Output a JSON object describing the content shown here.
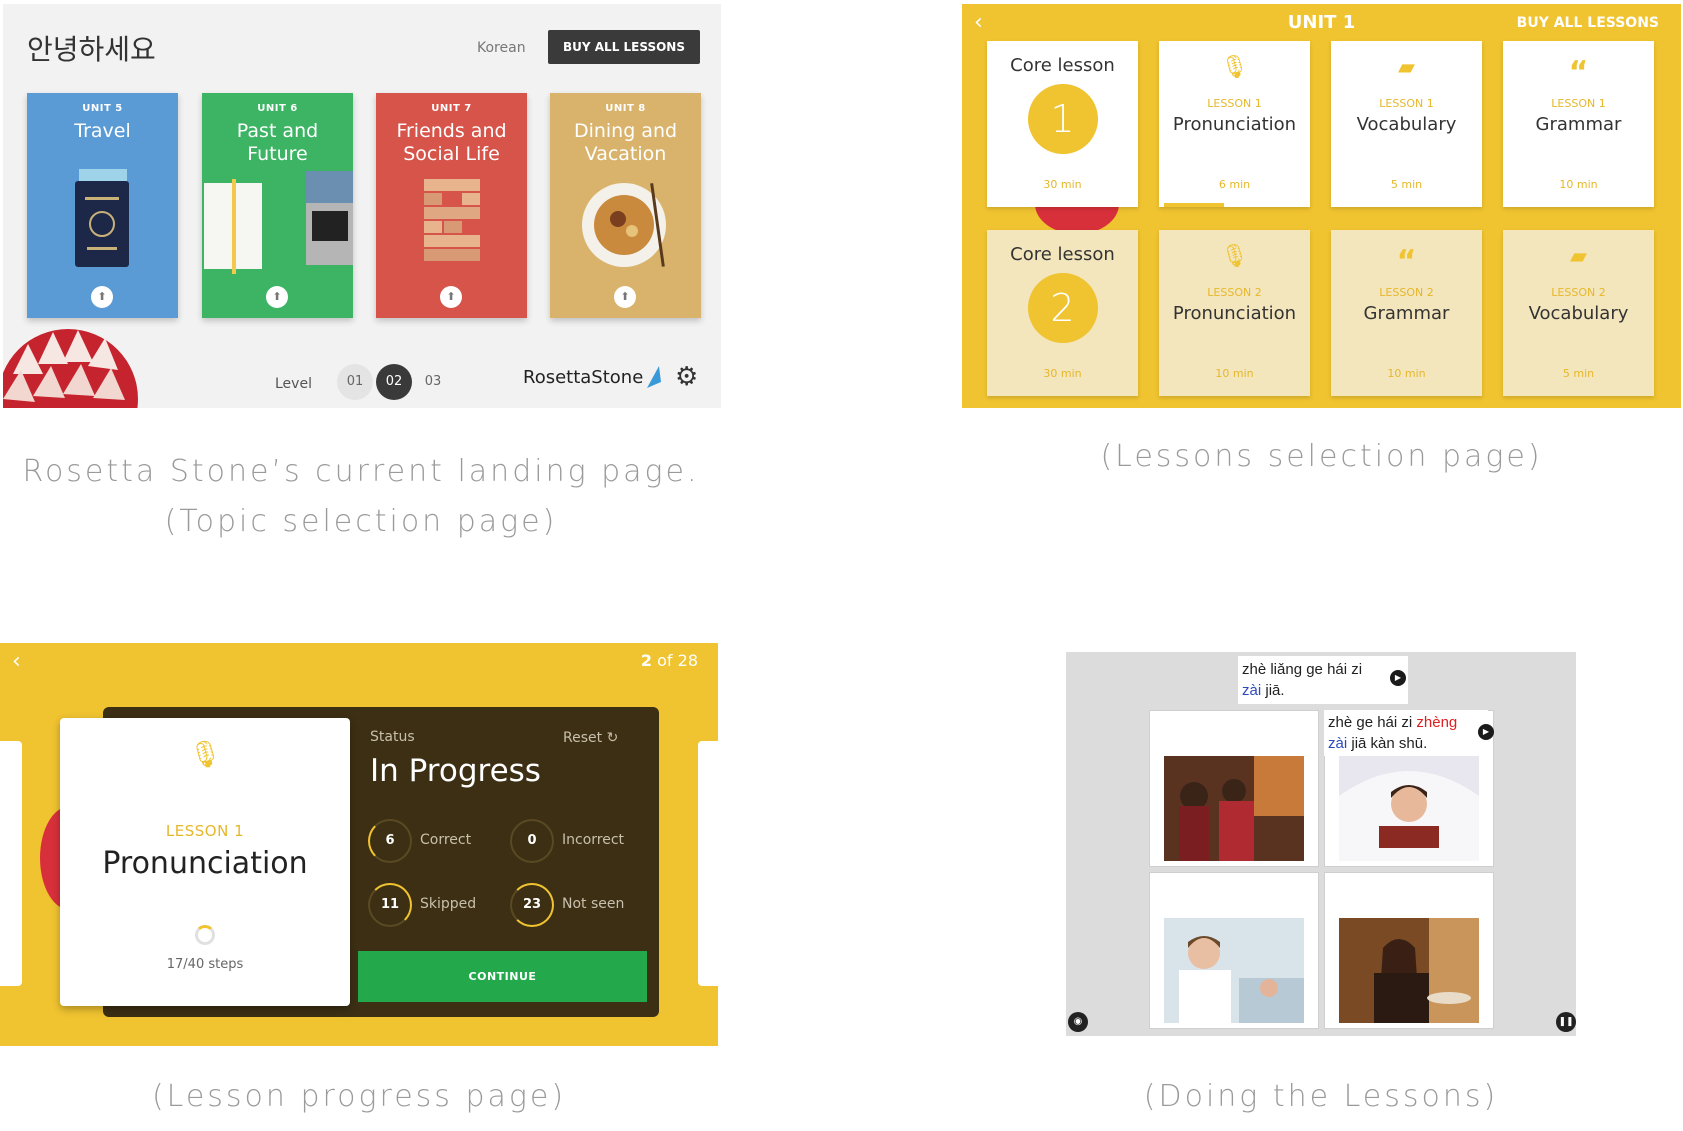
{
  "landing": {
    "greeting": "안녕하세요",
    "language": "Korean",
    "buy_all": "BUY ALL LESSONS",
    "units": [
      {
        "label": "UNIT 5",
        "title": "Travel",
        "color": "#5b9bd5"
      },
      {
        "label": "UNIT 6",
        "title": "Past and Future",
        "color": "#3cb464"
      },
      {
        "label": "UNIT 7",
        "title": "Friends and Social Life",
        "color": "#d6544a"
      },
      {
        "label": "UNIT 8",
        "title": "Dining and Vacation",
        "color": "#d9b36b"
      }
    ],
    "level_label": "Level",
    "levels": [
      "01",
      "02",
      "03"
    ],
    "selected_level": "02",
    "brand": "RosettaStone"
  },
  "lessons_page": {
    "title": "UNIT 1",
    "buy_all": "BUY ALL LESSONS",
    "row1": [
      {
        "type": "core",
        "title": "Core lesson",
        "number": "1",
        "duration": "30 min"
      },
      {
        "type": "lesson",
        "icon": "microphone-icon",
        "lesson": "LESSON 1",
        "name": "Pronunciation",
        "duration": "6 min",
        "progress": 0.4
      },
      {
        "type": "lesson",
        "icon": "book-icon",
        "lesson": "LESSON 1",
        "name": "Vocabulary",
        "duration": "5 min"
      },
      {
        "type": "lesson",
        "icon": "quote-icon",
        "lesson": "LESSON 1",
        "name": "Grammar",
        "duration": "10 min"
      }
    ],
    "row2": [
      {
        "type": "core",
        "title": "Core lesson",
        "number": "2",
        "duration": "30 min"
      },
      {
        "type": "lesson",
        "icon": "microphone-icon",
        "lesson": "LESSON 2",
        "name": "Pronunciation",
        "duration": "10 min"
      },
      {
        "type": "lesson",
        "icon": "quote-icon",
        "lesson": "LESSON 2",
        "name": "Grammar",
        "duration": "10 min"
      },
      {
        "type": "lesson",
        "icon": "book-icon",
        "lesson": "LESSON 2",
        "name": "Vocabulary",
        "duration": "5 min"
      }
    ]
  },
  "progress_page": {
    "count_bold": "2",
    "count_rest": " of 28",
    "lesson": "LESSON 1",
    "name": "Pronunciation",
    "steps": "17/40 steps",
    "status_label": "Status",
    "reset": "Reset",
    "status": "In Progress",
    "stats": [
      {
        "value": "6",
        "label": "Correct"
      },
      {
        "value": "0",
        "label": "Incorrect"
      },
      {
        "value": "11",
        "label": "Skipped"
      },
      {
        "value": "23",
        "label": "Not seen"
      }
    ],
    "continue": "CONTINUE"
  },
  "doing_page": {
    "prompt_line1": "zhè liǎng ge hái zi",
    "prompt_line2_blue": "zài",
    "prompt_line2_rest": " jiā.",
    "bubble_a": "zhè ge hái zi ",
    "bubble_red": "zhèng",
    "bubble_blue": "zài",
    "bubble_rest": " jiā kàn shū."
  },
  "captions": {
    "landing_1": "Rosetta Stone’s current landing page.",
    "landing_2": "(Topic selection page)",
    "lessons": "(Lessons selection page)",
    "progress": "(Lesson progress page)",
    "doing": "(Doing the Lessons)"
  },
  "colors": {
    "accent_yellow": "#f0c330",
    "continue_green": "#23a94c",
    "progress_dark": "#3c2f13"
  }
}
